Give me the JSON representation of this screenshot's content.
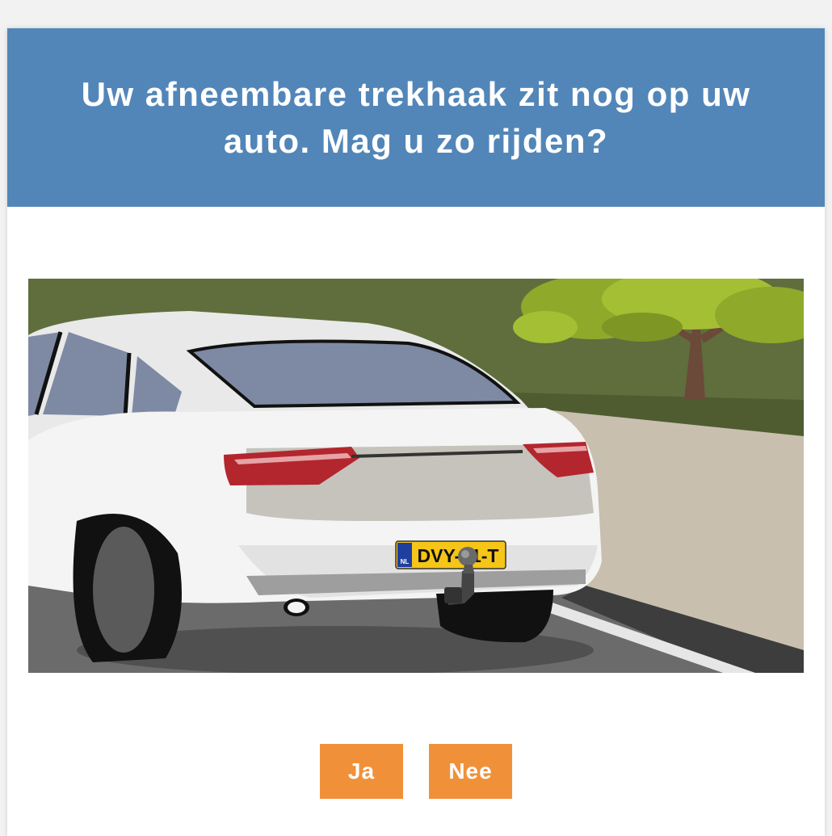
{
  "question": {
    "text": "Uw afneembare trekhaak zit nog op uw auto. Mag u zo rijden?"
  },
  "illustration": {
    "plate_country": "NL",
    "plate_text": "DVY-41-T"
  },
  "answers": [
    {
      "label": "Ja"
    },
    {
      "label": "Nee"
    }
  ],
  "colors": {
    "header": "#5286b8",
    "button": "#f0913a",
    "text_on_accent": "#ffffff"
  }
}
